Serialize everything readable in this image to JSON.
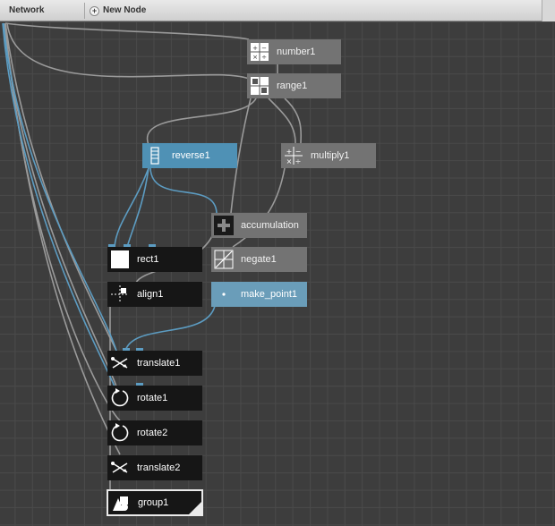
{
  "toolbar": {
    "title": "Network",
    "new_node_label": "New Node"
  },
  "nodes": {
    "number1": "number1",
    "range1": "range1",
    "reverse1": "reverse1",
    "multiply1": "multiply1",
    "accumulation": "accumulation",
    "rect1": "rect1",
    "negate1": "negate1",
    "align1": "align1",
    "make_point1": "make_point1",
    "translate1": "translate1",
    "rotate1": "rotate1",
    "rotate2": "rotate2",
    "translate2": "translate2",
    "group1": "group1"
  },
  "colors": {
    "gray_node": "#737373",
    "black_node": "#161616",
    "blue_node": "#4f91b5",
    "gray_wire": "#9a9a9a",
    "blue_wire": "#5c9cc2"
  }
}
